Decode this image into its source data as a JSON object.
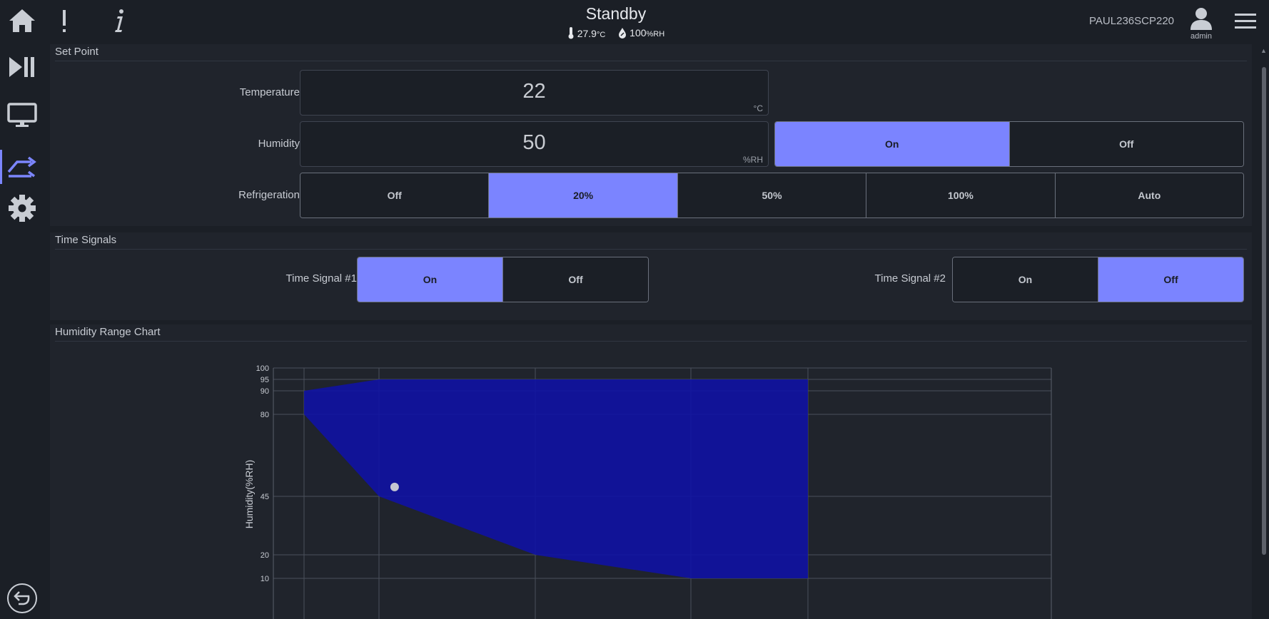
{
  "header": {
    "status_title": "Standby",
    "temperature_value": "27.9",
    "temperature_unit": "°C",
    "humidity_value": "100",
    "humidity_unit": "%RH",
    "device_name": "PAUL236SCP220",
    "user_label": "admin"
  },
  "sidebar": {
    "items": [
      {
        "icon": "play-pause-icon",
        "active": false
      },
      {
        "icon": "monitor-icon",
        "active": false
      },
      {
        "icon": "transfer-arrows-icon",
        "active": true
      },
      {
        "icon": "gear-icon",
        "active": false
      }
    ],
    "back_icon": "back-icon"
  },
  "set_point": {
    "title": "Set Point",
    "temperature": {
      "label": "Temperature",
      "value": "22",
      "unit": "°C"
    },
    "humidity": {
      "label": "Humidity",
      "value": "50",
      "unit": "%RH",
      "toggle": [
        {
          "label": "On",
          "selected": true
        },
        {
          "label": "Off",
          "selected": false
        }
      ]
    },
    "refrigeration": {
      "label": "Refrigeration",
      "options": [
        {
          "label": "Off",
          "selected": false
        },
        {
          "label": "20%",
          "selected": true
        },
        {
          "label": "50%",
          "selected": false
        },
        {
          "label": "100%",
          "selected": false
        },
        {
          "label": "Auto",
          "selected": false
        }
      ]
    }
  },
  "time_signals": {
    "title": "Time Signals",
    "signal1": {
      "label": "Time Signal #1",
      "options": [
        {
          "label": "On",
          "selected": true
        },
        {
          "label": "Off",
          "selected": false
        }
      ]
    },
    "signal2": {
      "label": "Time Signal #2",
      "options": [
        {
          "label": "On",
          "selected": false
        },
        {
          "label": "Off",
          "selected": true
        }
      ]
    }
  },
  "chart_panel": {
    "title": "Humidity Range Chart"
  },
  "colors": {
    "accent": "#7b84ff",
    "background": "#1b1f26",
    "panel": "#20242c",
    "range_fill": "#0f12a3"
  },
  "chart_data": {
    "type": "area",
    "title": "",
    "xlabel": "",
    "ylabel": "Humidity(%RH)",
    "y_ticks": [
      10,
      20,
      45,
      80,
      90,
      95,
      100
    ],
    "range_polygon": [
      {
        "x": 5,
        "y": 90
      },
      {
        "x": 10,
        "y": 95
      },
      {
        "x": 80,
        "y": 95
      },
      {
        "x": 80,
        "y": 10
      },
      {
        "x": 60,
        "y": 10
      },
      {
        "x": 20,
        "y": 20
      },
      {
        "x": 10,
        "y": 45
      },
      {
        "x": 5,
        "y": 80
      }
    ],
    "x_gridlines": [
      5,
      10,
      20,
      60,
      80
    ],
    "current_point": {
      "x": 11,
      "y": 49
    },
    "grid": true
  }
}
